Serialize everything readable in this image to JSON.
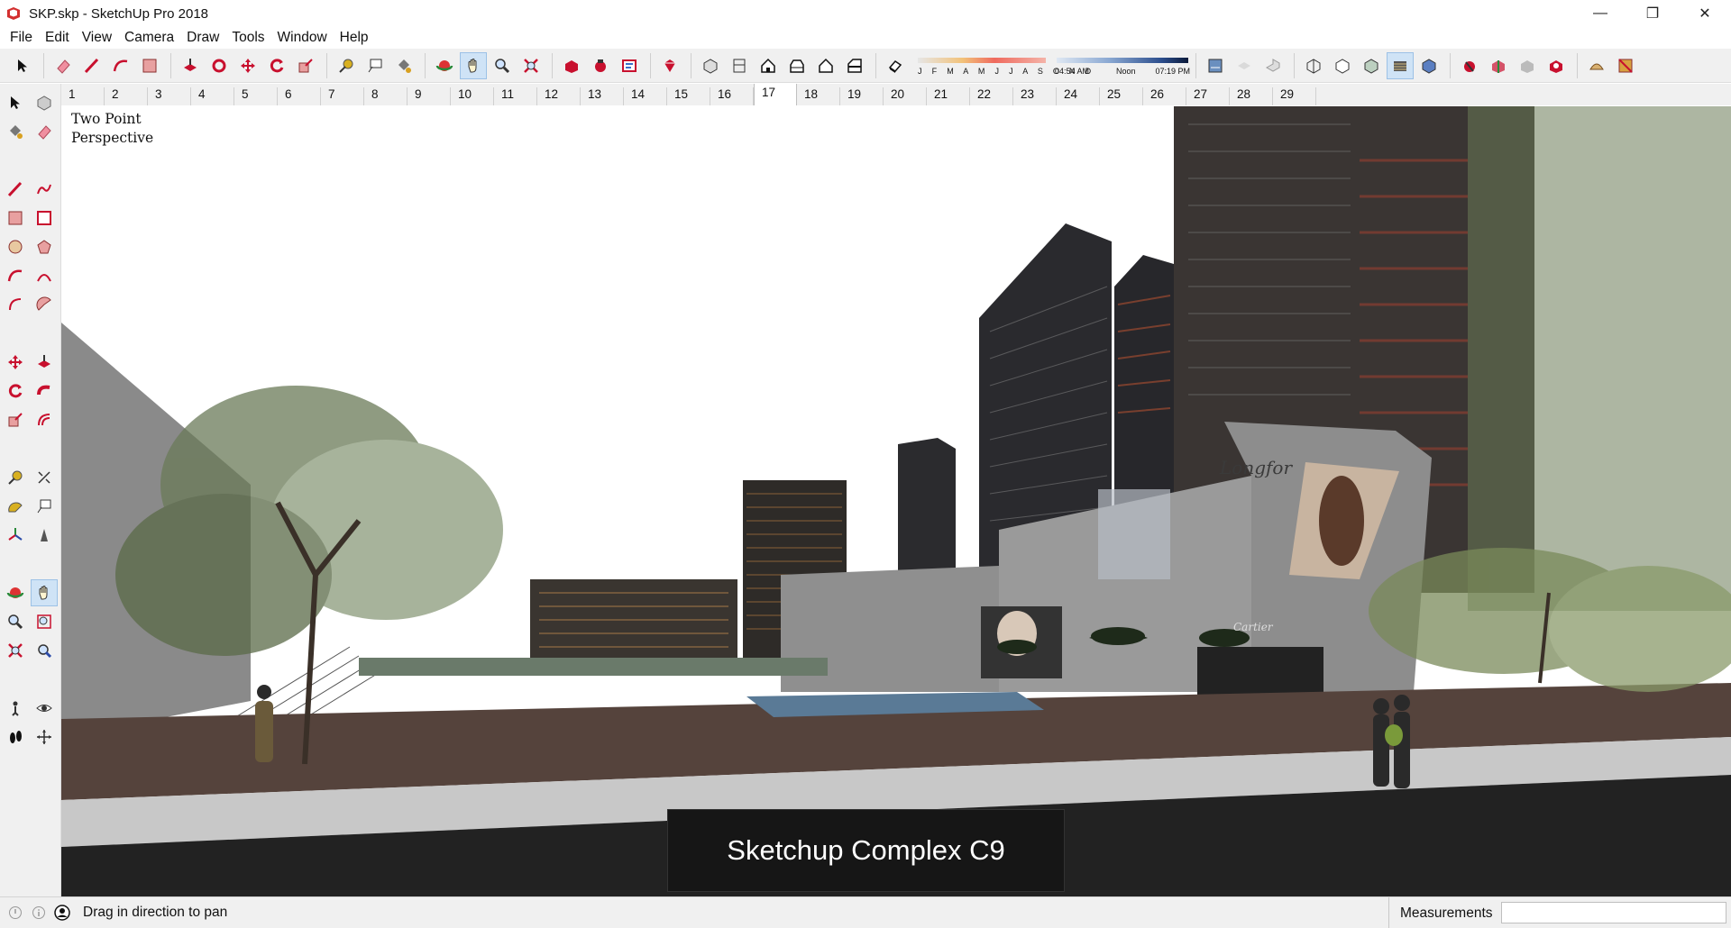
{
  "window": {
    "title": "SKP.skp - SketchUp Pro 2018",
    "controls": {
      "minimize": "—",
      "maximize": "❐",
      "close": "✕"
    }
  },
  "menu": [
    "File",
    "Edit",
    "View",
    "Camera",
    "Draw",
    "Tools",
    "Window",
    "Help"
  ],
  "toolbar": {
    "tools": [
      "select-icon",
      "eraser-icon",
      "line-icon",
      "arc-icon",
      "rectangle-icon",
      "push-pull-icon",
      "follow-me-icon",
      "move-icon",
      "rotate-icon",
      "scale-icon",
      "tape-measure-icon",
      "text-icon",
      "paint-bucket-icon",
      "orbit-icon",
      "pan-icon",
      "zoom-icon",
      "zoom-extents-icon",
      "warehouse-icon",
      "extension-warehouse-icon",
      "layout-icon",
      "ruby-icon",
      "iso-view-icon",
      "top-view-icon",
      "front-view-icon",
      "right-view-icon",
      "back-view-icon",
      "left-view-icon",
      "shadows-icon"
    ],
    "shadow_months": "J F M A M J J A S O N D",
    "shadow_time_start": "04:54 AM",
    "shadow_time_mid": "Noon",
    "shadow_time_end": "07:19 PM",
    "styles": [
      "xray-icon",
      "back-edges-icon",
      "wireframe-icon",
      "hidden-line-icon",
      "shaded-icon",
      "shaded-textures-icon",
      "monochrome-icon",
      "section-plane-icon",
      "section-cuts-icon",
      "section-fill-icon",
      "section-display-icon",
      "sandbox-icon",
      "solid-tools-icon"
    ]
  },
  "scenes": [
    "1",
    "2",
    "3",
    "4",
    "5",
    "6",
    "7",
    "8",
    "9",
    "10",
    "11",
    "12",
    "13",
    "14",
    "15",
    "16",
    "17",
    "18",
    "19",
    "20",
    "21",
    "22",
    "23",
    "24",
    "25",
    "26",
    "27",
    "28",
    "29"
  ],
  "selected_scene": "17",
  "left_tools": [
    "select-icon",
    "component-icon",
    "paint-bucket-icon",
    "eraser-icon",
    "line-icon",
    "freehand-icon",
    "rectangle-icon",
    "rotated-rectangle-icon",
    "circle-icon",
    "polygon-icon",
    "arc-icon",
    "two-point-arc-icon",
    "pie-icon",
    "three-point-arc-icon",
    "move-icon",
    "push-pull-icon",
    "rotate-icon",
    "follow-me-icon",
    "scale-icon",
    "offset-icon",
    "tape-measure-icon",
    "dimension-icon",
    "protractor-icon",
    "text-icon",
    "axes-icon",
    "3d-text-icon",
    "orbit-icon",
    "pan-icon",
    "zoom-icon",
    "zoom-window-icon",
    "zoom-extents-icon",
    "previous-view-icon",
    "position-camera-icon",
    "look-around-icon",
    "walk-icon",
    "section-plane-icon"
  ],
  "viewport": {
    "view_label_line1": "Two Point",
    "view_label_line2": "Perspective",
    "caption": "Sketchup Complex C9",
    "signage_1": "Longfor",
    "signage_2": "Cartier"
  },
  "status": {
    "message": "Drag in direction to pan",
    "measurements_label": "Measurements",
    "measurements_value": ""
  },
  "colors": {
    "active_tool_bg": "#cfe3f6",
    "chrome_bg": "#f0f0f0",
    "app_red": "#c8102e"
  }
}
